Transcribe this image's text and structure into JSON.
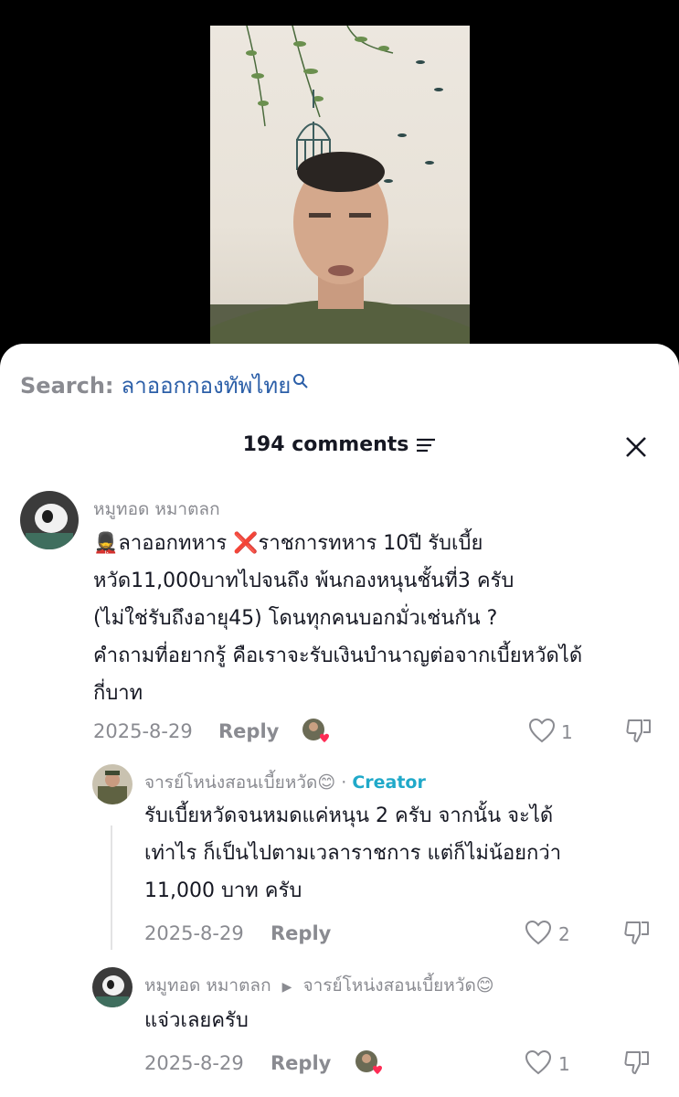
{
  "search": {
    "prefix": "Search:",
    "query": "ลาออกกองทัพไทย"
  },
  "comments_header": {
    "count_label": "194 comments"
  },
  "comments": [
    {
      "username": "หมูทอด หมาตลก",
      "text_lines": [
        "💂ลาออกทหาร ❌ราชการทหาร 10ปี รับเบี้ย",
        "หวัด11,000บาทไปจนถึง พ้นกองหนุนชั้นที่3 ครับ",
        "(ไม่ใช่รับถึงอายุ45) โดนทุกคนบอกมั่วเช่นกัน ?",
        "คำถามที่อยากรู้ คือเราจะรับเงินบำนาญต่อจากเบี้ยหวัดได้",
        "กี่บาท"
      ],
      "date": "2025-8-29",
      "reply_label": "Reply",
      "likes": "1"
    },
    {
      "username": "จารย์โหน่งสอนเบี้ยหวัด😊",
      "creator_dot": "·",
      "creator_label": "Creator",
      "text_lines": [
        "รับเบี้ยหวัดจนหมดแค่หนุน 2 ครับ จากนั้น จะได้",
        "เท่าไร ก็เป็นไปตามเวลาราชการ แต่ก็ไม่น้อยกว่า",
        "11,000 บาท ครับ"
      ],
      "date": "2025-8-29",
      "reply_label": "Reply",
      "likes": "2"
    },
    {
      "username": "หมูทอด หมาตลก",
      "reply_to": "จารย์โหน่งสอนเบี้ยหวัด😊",
      "text_lines": [
        "แจ่วเลยครับ"
      ],
      "date": "2025-8-29",
      "reply_label": "Reply",
      "likes": "1"
    }
  ],
  "colors": {
    "creator": "#20a9c9",
    "query": "#2c5fa8",
    "muted": "#8a8b91",
    "heart": "#fe2c55"
  },
  "icons": [
    "search-icon",
    "filter-icon",
    "close-icon",
    "heart-outline-icon",
    "dislike-icon"
  ]
}
